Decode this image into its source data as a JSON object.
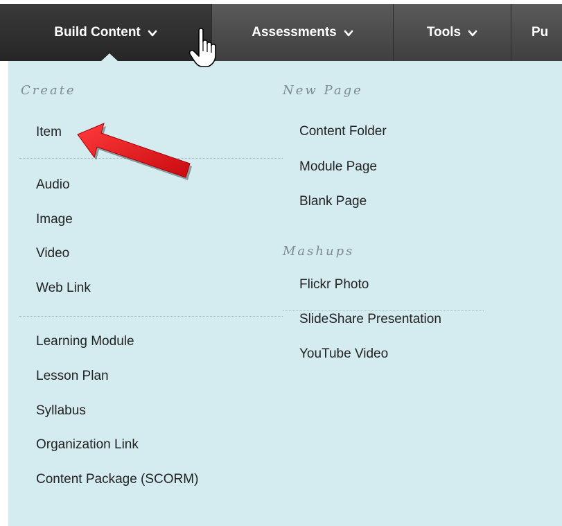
{
  "toolbar": {
    "items": [
      {
        "label": "Build Content"
      },
      {
        "label": "Assessments"
      },
      {
        "label": "Tools"
      },
      {
        "label": "Pu"
      }
    ]
  },
  "menu": {
    "create": {
      "heading": "Create",
      "group1": [
        "Item"
      ],
      "group2": [
        "Audio",
        "Image",
        "Video",
        "Web Link"
      ],
      "group3": [
        "Learning Module",
        "Lesson Plan",
        "Syllabus",
        "Organization Link",
        "Content Package (SCORM)"
      ]
    },
    "new_page": {
      "heading": "New Page",
      "items": [
        "Content Folder",
        "Module Page",
        "Blank Page"
      ]
    },
    "mashups": {
      "heading": "Mashups",
      "items": [
        "Flickr Photo",
        "SlideShare Presentation",
        "YouTube Video"
      ]
    }
  },
  "colors": {
    "toolbar_bg": "#4a4a4a",
    "panel_bg": "#d4ebf0",
    "arrow": "#e8121a"
  },
  "icons": {
    "dropdown": "chevron-down-icon",
    "cursor": "hand-pointer-cursor-icon",
    "annotation": "red-arrow-icon"
  }
}
